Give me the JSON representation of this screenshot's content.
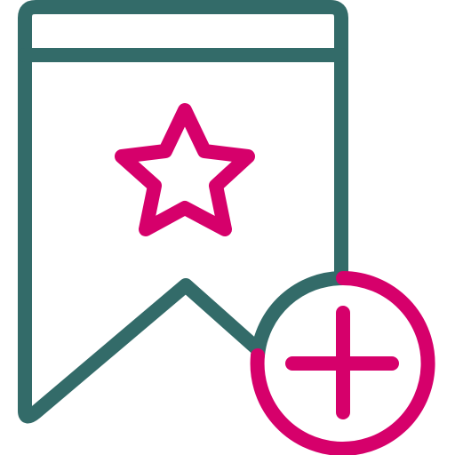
{
  "icon": {
    "name": "add-bookmark-star-icon",
    "colors": {
      "outline": "#336b69",
      "accent": "#d6006b",
      "background": "#ffffff"
    },
    "parts": [
      "bookmark-outline-icon",
      "bookmark-header-band",
      "star-icon",
      "plus-circle-icon"
    ]
  }
}
